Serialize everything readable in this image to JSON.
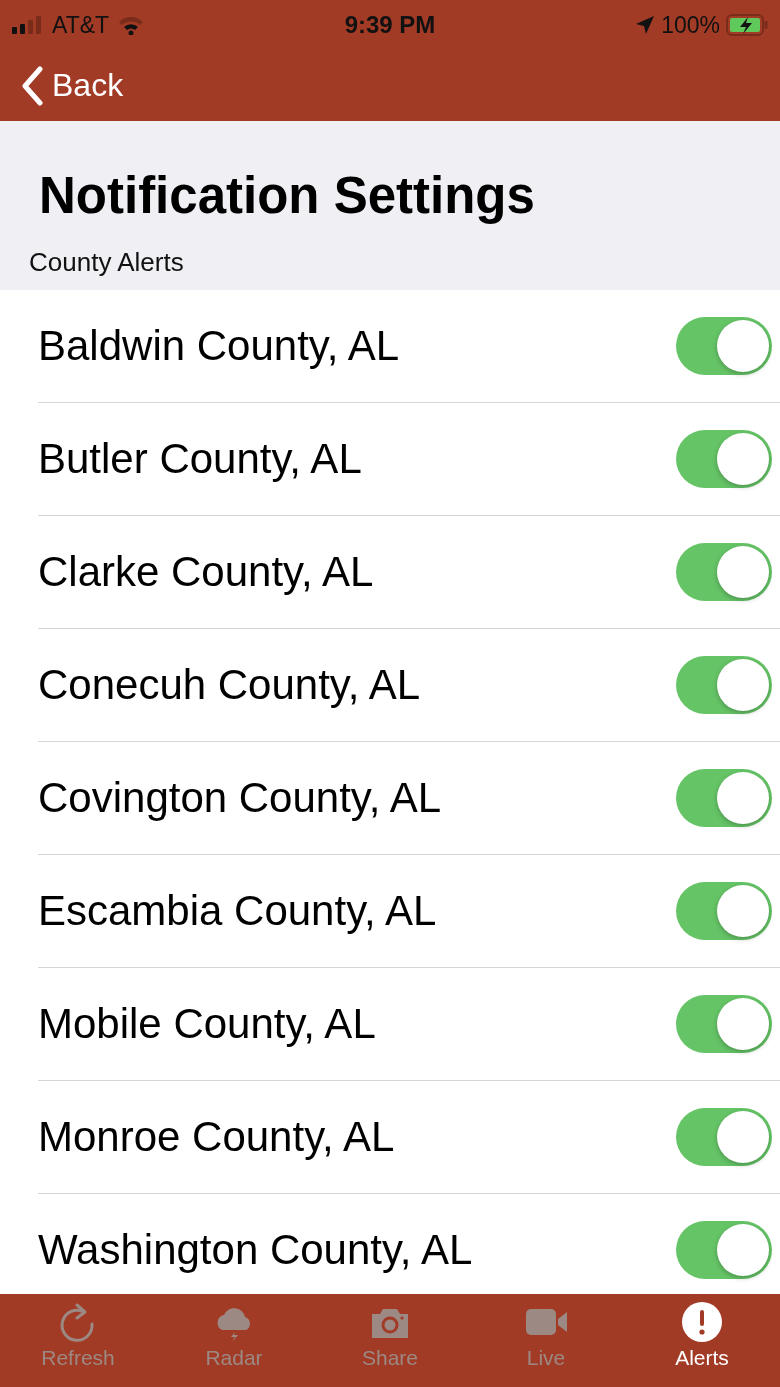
{
  "status_bar": {
    "carrier": "AT&T",
    "time": "9:39 PM",
    "battery": "100%"
  },
  "nav_bar": {
    "back": "Back"
  },
  "title": "Notification Settings",
  "section": "County Alerts",
  "counties": [
    {
      "name": "Baldwin County, AL",
      "on": true
    },
    {
      "name": "Butler County, AL",
      "on": true
    },
    {
      "name": "Clarke County, AL",
      "on": true
    },
    {
      "name": "Conecuh County, AL",
      "on": true
    },
    {
      "name": "Covington County, AL",
      "on": true
    },
    {
      "name": "Escambia County, AL",
      "on": true
    },
    {
      "name": "Mobile County, AL",
      "on": true
    },
    {
      "name": "Monroe County, AL",
      "on": true
    },
    {
      "name": "Washington County, AL",
      "on": true
    }
  ],
  "tab_bar": [
    {
      "kind": "refresh",
      "label": "Refresh",
      "selected": false
    },
    {
      "kind": "radar",
      "label": "Radar",
      "selected": false
    },
    {
      "kind": "share",
      "label": "Share",
      "selected": false
    },
    {
      "kind": "live",
      "label": "Live",
      "selected": false
    },
    {
      "kind": "alerts",
      "label": "Alerts",
      "selected": true
    }
  ]
}
